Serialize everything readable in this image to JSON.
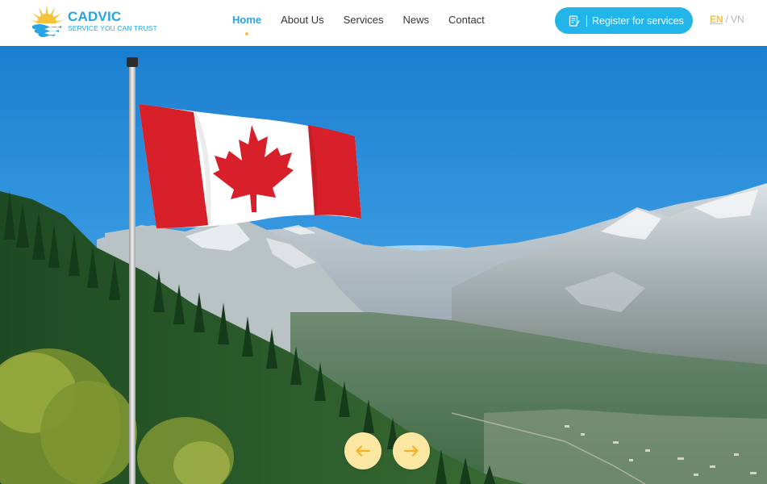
{
  "brand": {
    "name": "CADVIC",
    "tagline": "SERVICE YOU CAN TRUST",
    "logo_icon": "sun-over-waves-logo-icon",
    "colors": {
      "primary": "#27a4e1",
      "accent": "#f5c23a",
      "button": "#23b4ea"
    }
  },
  "nav": {
    "items": [
      {
        "label": "Home",
        "active": true
      },
      {
        "label": "About Us",
        "active": false
      },
      {
        "label": "Services",
        "active": false
      },
      {
        "label": "News",
        "active": false
      },
      {
        "label": "Contact",
        "active": false
      }
    ]
  },
  "cta": {
    "label": "Register for services",
    "icon": "form-document-icon"
  },
  "language": {
    "current": "EN",
    "separator": "/",
    "other": "VN"
  },
  "hero": {
    "image": "canadian-flag-on-pole-over-mountain-valley",
    "prev_icon": "arrow-left-icon",
    "next_icon": "arrow-right-icon"
  }
}
